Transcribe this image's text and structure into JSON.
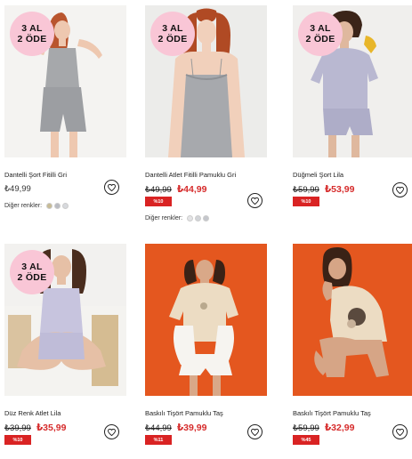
{
  "products": [
    {
      "badge_line1": "3 AL",
      "badge_line2": "2 ÖDE",
      "title": "Dantelli Şort Fitilli Gri",
      "price": "₺49,99",
      "other_colors_label": "Diğer renkler:",
      "swatches": [
        "#c7bb95",
        "#b9bbc2",
        "#d7d9dd"
      ]
    },
    {
      "badge_line1": "3 AL",
      "badge_line2": "2 ÖDE",
      "title": "Dantelli Atlet Fitilli Pamuklu Gri",
      "old_price": "₺49,99",
      "new_price": "₺44,99",
      "discount": "%10",
      "other_colors_label": "Diğer renkler:",
      "swatches": [
        "#e4e4e6",
        "#d2d4d8",
        "#c4c6cc"
      ]
    },
    {
      "badge_line1": "3 AL",
      "badge_line2": "2 ÖDE",
      "title": "Düğmeli Şort Lila",
      "old_price": "₺59,99",
      "new_price": "₺53,99",
      "discount": "%10"
    },
    {
      "badge_line1": "3 AL",
      "badge_line2": "2 ÖDE",
      "title": "Düz Renk Atlet Lila",
      "old_price": "₺39,99",
      "new_price": "₺35,99",
      "discount": "%10"
    },
    {
      "title": "Baskılı Tişört Pamuklu Taş",
      "old_price": "₺44,99",
      "new_price": "₺39,99",
      "discount": "%11"
    },
    {
      "title": "Baskılı Tişört Pamuklu Taş",
      "old_price": "₺59,99",
      "new_price": "₺32,99",
      "discount": "%45"
    }
  ],
  "colors": {
    "badge_pink": "#f9c6d6",
    "discount_red": "#d92323",
    "sale_price_red": "#d62b2b",
    "orange_backdrop": "#e4571f"
  },
  "icons": {
    "favorite": "heart-icon"
  }
}
